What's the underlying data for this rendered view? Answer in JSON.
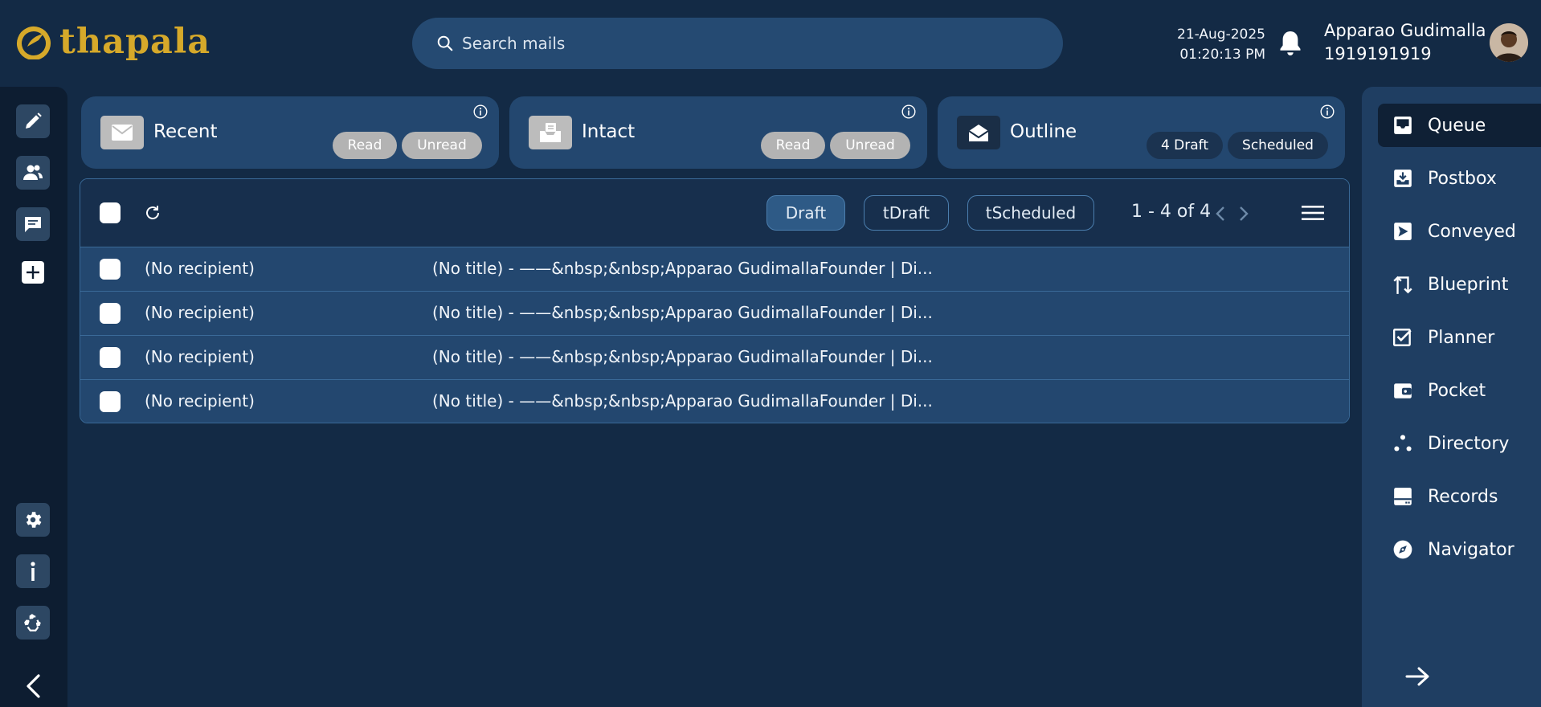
{
  "brand": {
    "name": "thapala"
  },
  "search": {
    "placeholder": "Search mails"
  },
  "header": {
    "date": "21-Aug-2025",
    "time": "01:20:13 PM",
    "user_name": "Apparao Gudimalla",
    "user_phone": "1919191919"
  },
  "cards": [
    {
      "title": "Recent",
      "pills": [
        "Read",
        "Unread"
      ]
    },
    {
      "title": "Intact",
      "pills": [
        "Read",
        "Unread"
      ]
    },
    {
      "title": "Outline",
      "pills": [
        "4 Draft",
        "Scheduled"
      ]
    }
  ],
  "toolbar": {
    "chips": [
      "Draft",
      "tDraft",
      "tScheduled"
    ],
    "active_chip": "Draft",
    "pagination": "1 - 4 of 4"
  },
  "rows": [
    {
      "recipient": "(No recipient)",
      "snippet": "(No title)  - ——&nbsp;&nbsp;Apparao GudimallaFounder | Di..."
    },
    {
      "recipient": "(No recipient)",
      "snippet": "(No title)  - ——&nbsp;&nbsp;Apparao GudimallaFounder | Di..."
    },
    {
      "recipient": "(No recipient)",
      "snippet": "(No title)  - ——&nbsp;&nbsp;Apparao GudimallaFounder | Di..."
    },
    {
      "recipient": "(No recipient)",
      "snippet": "(No title)  - ——&nbsp;&nbsp;Apparao GudimallaFounder | Di..."
    }
  ],
  "nav": {
    "active": "Queue",
    "items": [
      {
        "label": "Queue",
        "icon": "inbox-icon"
      },
      {
        "label": "Postbox",
        "icon": "download-tray-icon"
      },
      {
        "label": "Conveyed",
        "icon": "send-icon"
      },
      {
        "label": "Blueprint",
        "icon": "swap-arrows-icon"
      },
      {
        "label": "Planner",
        "icon": "checkbox-icon"
      },
      {
        "label": "Pocket",
        "icon": "wallet-icon"
      },
      {
        "label": "Directory",
        "icon": "dots-icon"
      },
      {
        "label": "Records",
        "icon": "archive-icon"
      },
      {
        "label": "Navigator",
        "icon": "compass-icon"
      }
    ]
  },
  "leftbar": {
    "icons": [
      "pencil-icon",
      "contacts-icon",
      "chat-icon",
      "add-icon",
      "settings-icon",
      "info-icon",
      "recycle-icon",
      "chevron-left-icon"
    ]
  },
  "colors": {
    "background": "#132a45",
    "card": "#23476f",
    "sidebar_left": "#0d1d31",
    "sidebar_right": "#1f3e62",
    "brand_gold": "#d6a92a",
    "search": "#254a72"
  }
}
